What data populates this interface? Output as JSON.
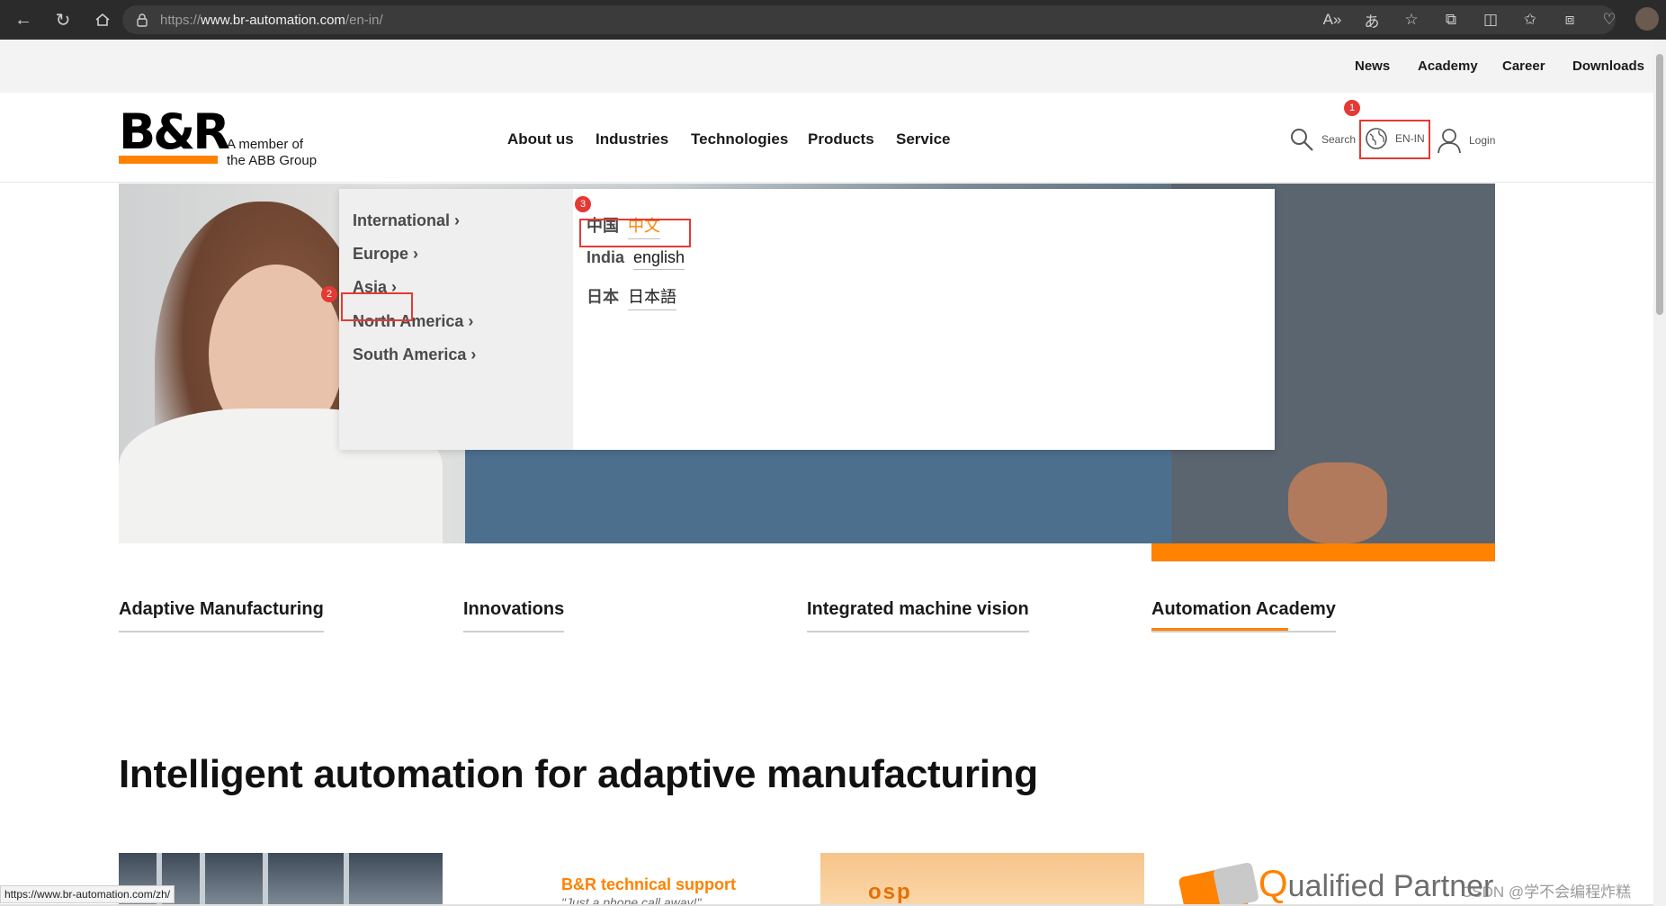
{
  "browser": {
    "url_prefix": "https://",
    "url_host": "www.br-automation.com",
    "url_path": "/en-in/",
    "status_url": "https://www.br-automation.com/zh/"
  },
  "utility_nav": [
    "News",
    "Academy",
    "Career",
    "Downloads"
  ],
  "header": {
    "logo": "B&R",
    "tagline_line1": "A member of",
    "tagline_line2": "the ABB Group",
    "main_nav": [
      "About us",
      "Industries",
      "Technologies",
      "Products",
      "Service"
    ],
    "search_label": "Search",
    "lang_label": "EN-IN",
    "login_label": "Login"
  },
  "annotations": [
    "1",
    "2",
    "3"
  ],
  "dropdown": {
    "regions": [
      "International",
      "Europe",
      "Asia",
      "North America",
      "South America"
    ],
    "chevron": "›",
    "languages": [
      {
        "country": "中国",
        "language": "中文"
      },
      {
        "country": "India",
        "language": "english"
      },
      {
        "country": "日本",
        "language": "日本語"
      }
    ]
  },
  "tabs": [
    "Adaptive Manufacturing",
    "Innovations",
    "Integrated machine vision",
    "Automation Academy"
  ],
  "headline": "Intelligent automation for adaptive manufacturing",
  "cards": {
    "support_title": "B&R technical support",
    "support_sub": "\"Just a phone call away!\"",
    "osp": "osp",
    "qp_initial": "Q",
    "qp_rest": "ualified Partner"
  },
  "watermark": "CSDN @学不会编程炸糕",
  "colors": {
    "accent": "#ff8200",
    "highlight": "#e53935"
  }
}
